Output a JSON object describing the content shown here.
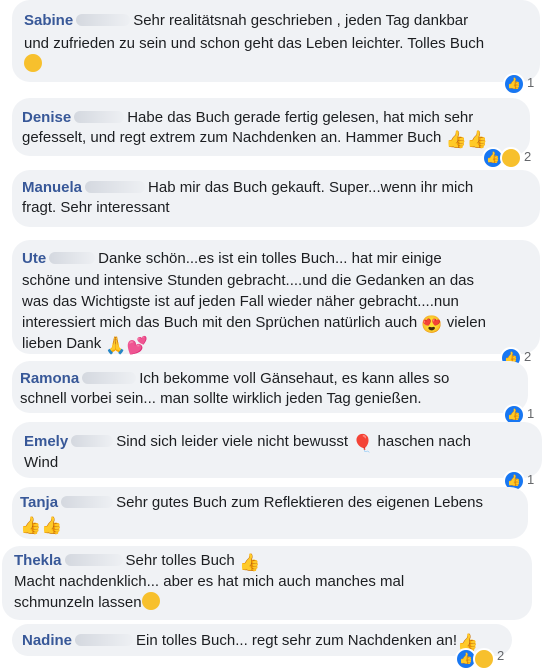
{
  "comments": [
    {
      "name": "Sabine",
      "text1": "Sehr realitätsnah geschrieben , jeden Tag dankbar",
      "text2": "und zufrieden zu sein und schon geht das Leben leichter. Tolles Buch",
      "reactions": "1"
    },
    {
      "name": "Denise",
      "text1": "Habe das Buch gerade fertig gelesen, hat mich sehr",
      "text2": "gefesselt, und regt extrem zum Nachdenken an. Hammer Buch",
      "reactions": "2"
    },
    {
      "name": "Manuela",
      "text1": "Hab mir das Buch gekauft. Super...wenn ihr mich",
      "text2": "fragt. Sehr interessant",
      "reactions": ""
    },
    {
      "name": "Ute",
      "text1": "Danke schön...es ist ein tolles Buch... hat mir einige",
      "text2": "schöne und intensive Stunden gebracht....und die Gedanken an das",
      "text3": "was das Wichtigste ist auf jeden Fall wieder näher gebracht....nun",
      "text4": "interessiert mich das Buch mit den Sprüchen natürlich auch",
      "text4b": "vielen",
      "text5": "lieben Dank",
      "reactions": "2"
    },
    {
      "name": "Ramona",
      "text1": "Ich bekomme voll Gänsehaut, es kann alles so",
      "text2": "schnell vorbei sein... man sollte wirklich jeden Tag genießen.",
      "reactions": "1"
    },
    {
      "name": "Emely",
      "text1": "Sind sich leider viele nicht bewusst",
      "text1b": "haschen nach",
      "text2": "Wind",
      "reactions": "1"
    },
    {
      "name": "Tanja",
      "text1": "Sehr gutes Buch zum Reflektieren des eigenen Lebens",
      "reactions": ""
    },
    {
      "name": "Thekla",
      "text1": "Sehr tolles Buch",
      "text2": "Macht nachdenklich... aber es hat mich auch manches mal",
      "text3": "schmunzeln lassen",
      "reactions": ""
    },
    {
      "name": "Nadine",
      "text1": "Ein tolles Buch... regt sehr zum Nachdenken an!",
      "reactions": "2"
    }
  ]
}
